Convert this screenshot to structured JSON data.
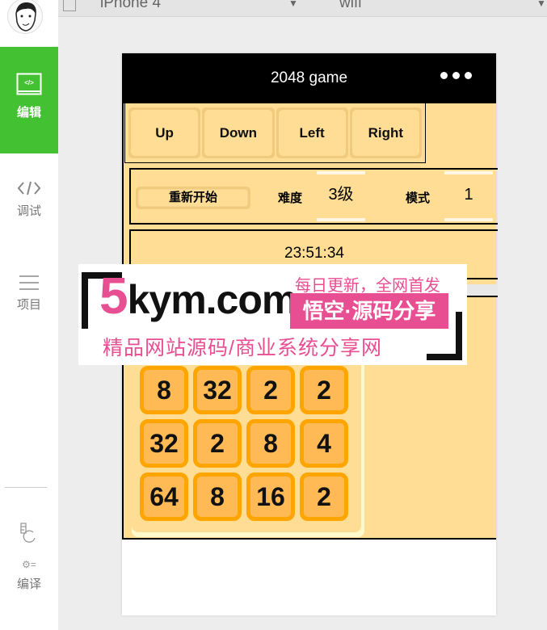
{
  "sidebar": {
    "items": [
      {
        "label": "编辑",
        "icon": "code-editor-icon",
        "active": true
      },
      {
        "label": "调试",
        "icon": "code-brackets-icon"
      },
      {
        "label": "项目",
        "icon": "menu-lines-icon"
      },
      {
        "label": "编译",
        "icon": "compile-icon"
      }
    ]
  },
  "toolbar": {
    "device": "iPhone 4",
    "network": "wifi"
  },
  "nav": {
    "title": "2048 game"
  },
  "controls": {
    "buttons": [
      "Up",
      "Down",
      "Left",
      "Right"
    ]
  },
  "options": {
    "restart": "重新开始",
    "difficulty_label": "难度",
    "difficulty_value": "3级",
    "mode_label": "模式",
    "mode_value": "1"
  },
  "timer": "23:51:34",
  "board": {
    "visible_rows": [
      [
        "8",
        "32",
        "2",
        "2"
      ],
      [
        "32",
        "2",
        "8",
        "4"
      ],
      [
        "64",
        "8",
        "16",
        "2"
      ]
    ]
  },
  "colors": {
    "accent": "#44c132",
    "background": "#ffdd94",
    "tile": "#ffba55",
    "tile_border": "#ffa500",
    "watermark": "#e84e92"
  },
  "watermark": {
    "logo_digit": "5",
    "logo_text": "kym.com",
    "tag1": "每日更新，全网首发",
    "tag2": "悟空·源码分享",
    "tag3": "精品网站源码/商业系统分享网"
  }
}
